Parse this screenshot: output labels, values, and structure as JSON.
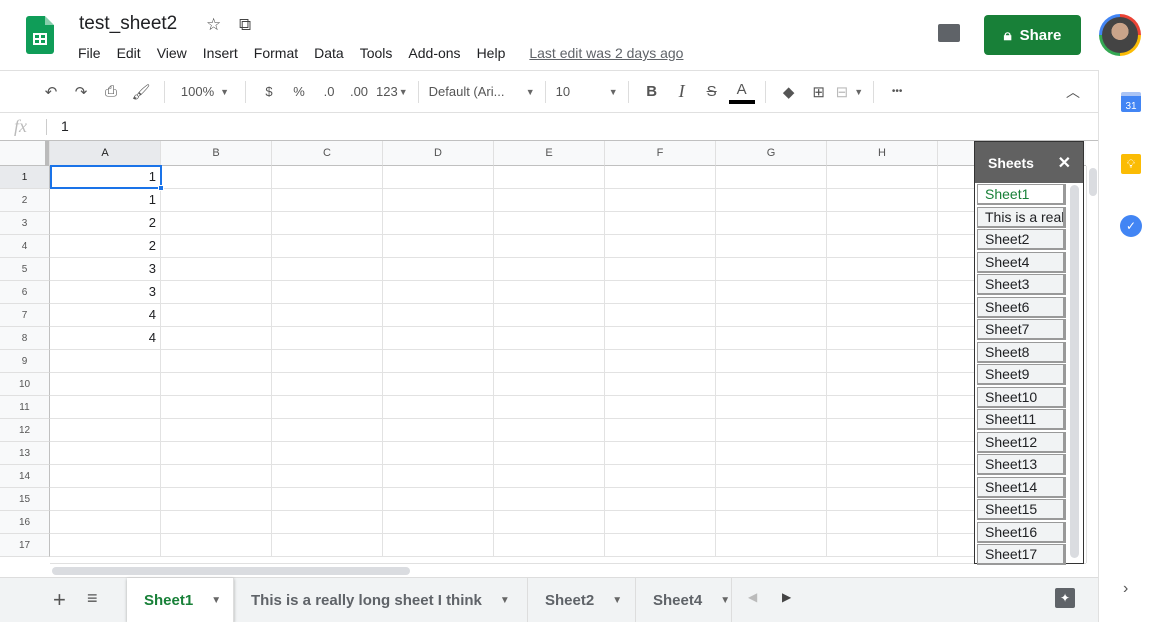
{
  "app": {
    "title": "test_sheet2",
    "last_edit": "Last edit was 2 days ago",
    "share_label": "Share"
  },
  "menu": [
    "File",
    "Edit",
    "View",
    "Insert",
    "Format",
    "Data",
    "Tools",
    "Add-ons",
    "Help"
  ],
  "toolbar": {
    "zoom": "100%",
    "currency": "$",
    "percent": "%",
    "dec_decrease": ".0",
    "dec_increase": ".00",
    "more_formats": "123",
    "font": "Default (Ari...",
    "font_size": "10",
    "bold": "B",
    "italic": "I",
    "strike": "S",
    "text_color": "A",
    "more": "•••",
    "text_color_value": "#000000"
  },
  "formula_bar": {
    "fx": "fx",
    "value": "1"
  },
  "columns": [
    "A",
    "B",
    "C",
    "D",
    "E",
    "F",
    "G",
    "H"
  ],
  "rows": [
    "1",
    "2",
    "3",
    "4",
    "5",
    "6",
    "7",
    "8",
    "9",
    "10",
    "11",
    "12",
    "13",
    "14",
    "15",
    "16",
    "17"
  ],
  "column_a_values": [
    "1",
    "1",
    "2",
    "2",
    "3",
    "3",
    "4",
    "4"
  ],
  "selected_cell": "A1",
  "sheets_panel": {
    "title": "Sheets",
    "close": "✕",
    "items": [
      "Sheet1",
      "This is a really long sheet I think",
      "Sheet2",
      "Sheet4",
      "Sheet3",
      "Sheet6",
      "Sheet7",
      "Sheet8",
      "Sheet9",
      "Sheet10",
      "Sheet11",
      "Sheet12",
      "Sheet13",
      "Sheet14",
      "Sheet15",
      "Sheet16",
      "Sheet17"
    ]
  },
  "tabs": [
    {
      "label": "Sheet1",
      "active": true
    },
    {
      "label": "This is a really long sheet I think"
    },
    {
      "label": "Sheet2"
    },
    {
      "label": "Sheet4"
    }
  ],
  "side_panel": {
    "calendar_day": "31"
  },
  "colors": {
    "accent": "#188038",
    "selection": "#1a73e8"
  }
}
